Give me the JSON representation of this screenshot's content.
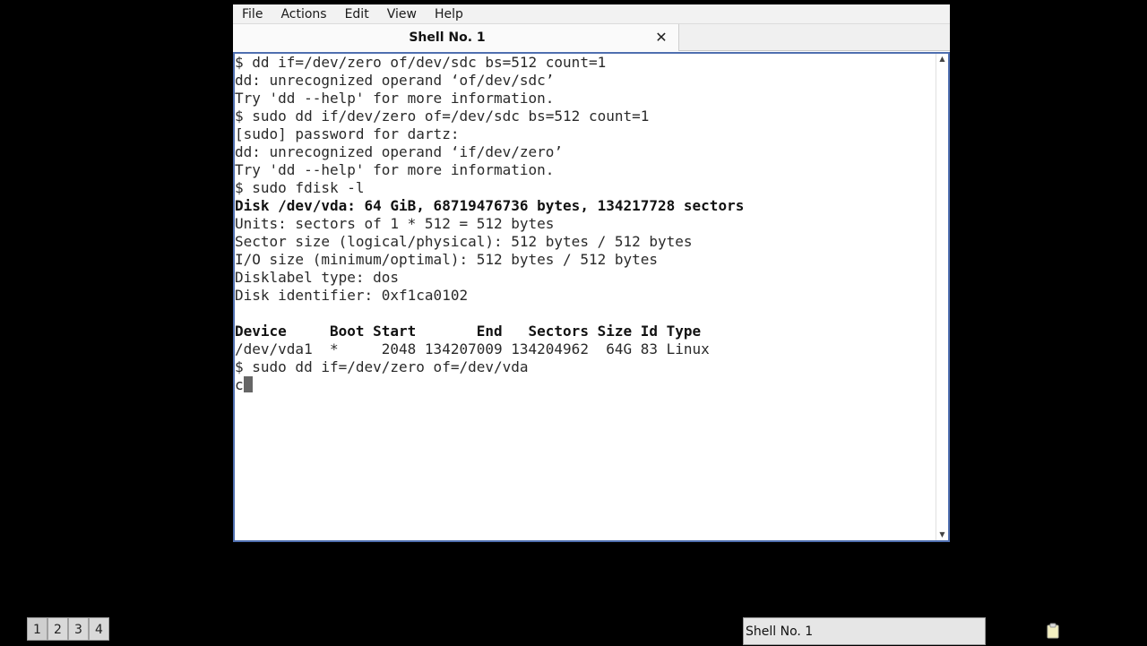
{
  "menubar": {
    "items": [
      "File",
      "Actions",
      "Edit",
      "View",
      "Help"
    ]
  },
  "tab": {
    "title": "Shell No. 1",
    "close_label": "✕"
  },
  "terminal": {
    "lines": [
      {
        "text": "$ dd if=/dev/zero of/dev/sdc bs=512 count=1",
        "bold": false
      },
      {
        "text": "dd: unrecognized operand ‘of/dev/sdc’",
        "bold": false
      },
      {
        "text": "Try 'dd --help' for more information.",
        "bold": false
      },
      {
        "text": "$ sudo dd if/dev/zero of=/dev/sdc bs=512 count=1",
        "bold": false
      },
      {
        "text": "[sudo] password for dartz:",
        "bold": false
      },
      {
        "text": "dd: unrecognized operand ‘if/dev/zero’",
        "bold": false
      },
      {
        "text": "Try 'dd --help' for more information.",
        "bold": false
      },
      {
        "text": "$ sudo fdisk -l",
        "bold": false
      },
      {
        "text": "Disk /dev/vda: 64 GiB, 68719476736 bytes, 134217728 sectors",
        "bold": true
      },
      {
        "text": "Units: sectors of 1 * 512 = 512 bytes",
        "bold": false
      },
      {
        "text": "Sector size (logical/physical): 512 bytes / 512 bytes",
        "bold": false
      },
      {
        "text": "I/O size (minimum/optimal): 512 bytes / 512 bytes",
        "bold": false
      },
      {
        "text": "Disklabel type: dos",
        "bold": false
      },
      {
        "text": "Disk identifier: 0xf1ca0102",
        "bold": false
      },
      {
        "text": "",
        "bold": false
      },
      {
        "text": "Device     Boot Start       End   Sectors Size Id Type",
        "bold": true
      },
      {
        "text": "/dev/vda1  *     2048 134207009 134204962  64G 83 Linux",
        "bold": false
      },
      {
        "text": "$ sudo dd if=/dev/zero of=/dev/vda",
        "bold": false
      }
    ],
    "prompt_line": "c"
  },
  "scrollbar": {
    "up_arrow": "▲",
    "down_arrow": "▼"
  },
  "taskbar": {
    "workspaces": [
      "1",
      "2",
      "3",
      "4"
    ],
    "task_label": "Shell No. 1"
  },
  "icons": {
    "tray": "clipboard-icon"
  },
  "colors": {
    "terminal_border": "#4f6fb0",
    "desktop": "#000000"
  }
}
